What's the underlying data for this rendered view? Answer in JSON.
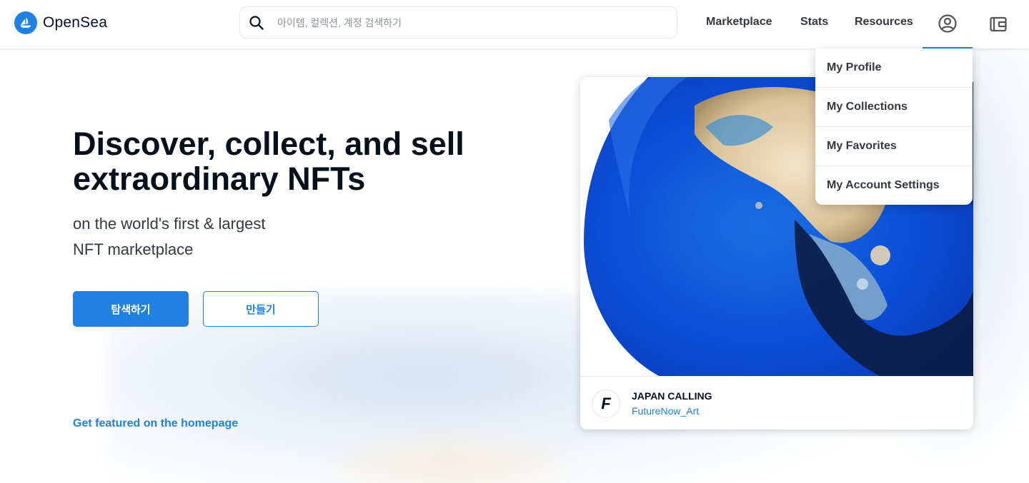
{
  "header": {
    "logo_text": "OpenSea",
    "search": {
      "placeholder": "아이템, 컬렉션, 계정 검색하기"
    },
    "nav": {
      "marketplace": "Marketplace",
      "stats": "Stats",
      "resources": "Resources"
    },
    "icons": [
      "search-icon",
      "account-circle-icon",
      "wallet-icon"
    ]
  },
  "account_menu": {
    "items": [
      "My Profile",
      "My Collections",
      "My Favorites",
      "My Account Settings"
    ]
  },
  "hero": {
    "title": "Discover, collect, and sell extraordinary NFTs",
    "subtitle_line1": "on the world's first & largest",
    "subtitle_line2": "NFT marketplace",
    "explore_button": "탐색하기",
    "create_button": "만들기",
    "featured_link": "Get featured on the homepage"
  },
  "featured_card": {
    "title": "JAPAN CALLING",
    "creator": "FutureNow_Art",
    "creator_avatar_glyph": "F"
  },
  "colors": {
    "accent": "#2081e2",
    "text_primary": "#04111d",
    "text_secondary": "#353840",
    "border": "#e5e8eb"
  }
}
